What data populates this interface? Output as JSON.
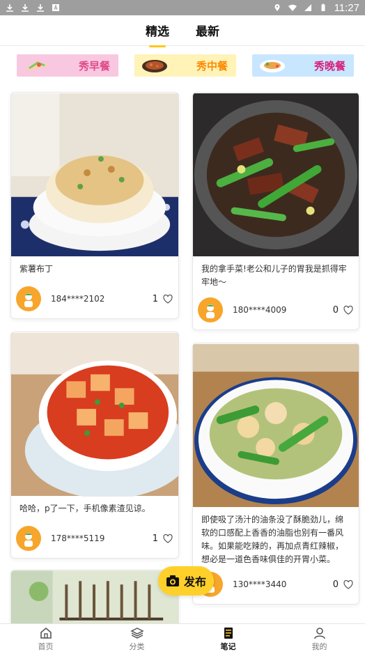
{
  "status_bar": {
    "time": "11:27"
  },
  "tabs": [
    {
      "label": "精选",
      "active": true
    },
    {
      "label": "最新",
      "active": false
    }
  ],
  "meals": [
    {
      "label": "秀早餐"
    },
    {
      "label": "秀中餐"
    },
    {
      "label": "秀晚餐"
    }
  ],
  "cards": [
    {
      "title": "紫薯布丁",
      "user": "184****2102",
      "likes": "1"
    },
    {
      "title": "我的拿手菜!老公和儿子的胃我是抓得牢牢地～",
      "user": "180****4009",
      "likes": "0"
    },
    {
      "title": "哈哈，p了一下，手机像素渣见谅。",
      "user": "178****5119",
      "likes": "1"
    },
    {
      "title": "即使吸了汤汁的油条没了酥脆劲儿，绵软的口感配上香香的油脂也别有一番风味。如果能吃辣的，再加点青红辣椒，想必是一道色香味俱佳的开胃小菜。",
      "user": "130****3440",
      "likes": "0"
    }
  ],
  "publish": {
    "label": "发布"
  },
  "bottom_nav": [
    {
      "label": "首页",
      "active": false
    },
    {
      "label": "分类",
      "active": false
    },
    {
      "label": "笔记",
      "active": true
    },
    {
      "label": "我的",
      "active": false
    }
  ],
  "colors": {
    "accent": "#ffc816",
    "status_bar": "#9e9e9e"
  }
}
